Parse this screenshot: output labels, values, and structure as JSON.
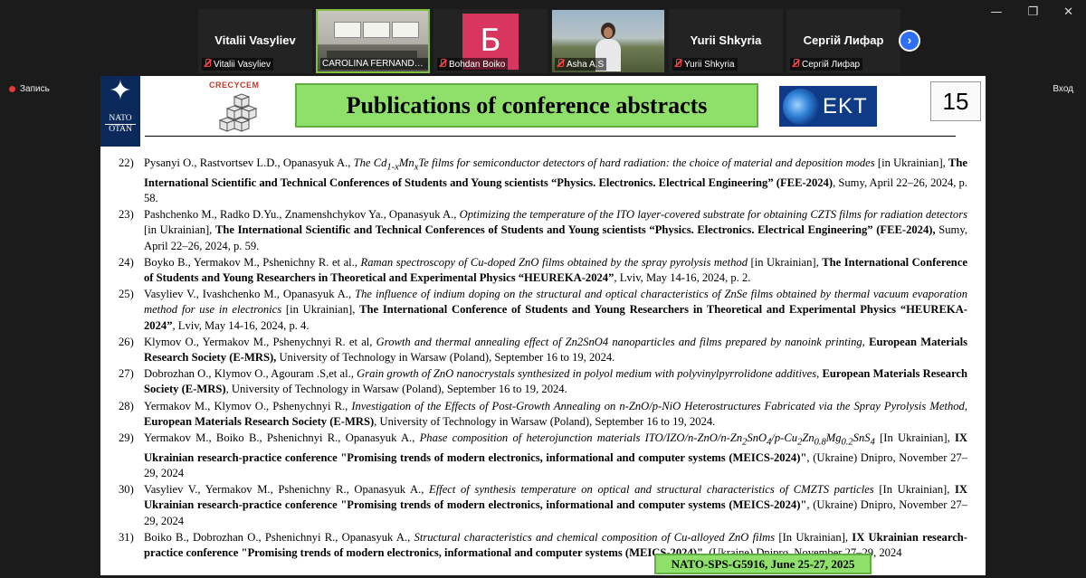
{
  "window": {
    "minimize": "—",
    "restore": "❐",
    "close": "✕"
  },
  "participants": [
    {
      "display": "Vitalii Vasyliev",
      "label": "Vitalii Vasyliev",
      "muted": true
    },
    {
      "display": "",
      "label": "CAROLINA FERNANDEZ S...",
      "muted": false,
      "video": "room"
    },
    {
      "display": "Б",
      "label": "Bohdan Boiko",
      "muted": true,
      "avatar_color": "#d8355f"
    },
    {
      "display": "",
      "label": "Asha A.S",
      "muted": true,
      "video": "person"
    },
    {
      "display": "Yurii Shkyria",
      "label": "Yurii Shkyria",
      "muted": true
    },
    {
      "display": "Сергій Лифар",
      "label": "Сергій Лифар",
      "muted": true
    }
  ],
  "next_button": "›",
  "record_label": "Запись",
  "exit_label": "Вход",
  "slide": {
    "nato_top": "NATO",
    "nato_bottom": "OTAN",
    "crecycle_text": "CRECYCEM",
    "title": "Publications of conference abstracts",
    "ekt_logo": "EKT",
    "page_number": "15",
    "footer": "NATO-SPS-G5916, June 25-27, 2025",
    "references": [
      {
        "n": "22)",
        "html": "Pysanyi O., Rastvortsev L.D., Opanasyuk A., <i>The Cd<sub>1-x</sub>Mn<sub>x</sub>Te films for semiconductor detectors of hard radiation: the choice of material and deposition modes</i> [in Ukrainian], <b>The International Scientific and Technical Conferences of Students and Young scientists “Physics. Electronics. Electrical Engineering” (FEE-2024)</b>, Sumy, April 22–26, 2024, p. 58."
      },
      {
        "n": "23)",
        "html": "Pashchenko M., Radko D.Yu., Znamenshchykov Ya., Opanasyuk A., <i>Optimizing the temperature of the ITO layer-covered substrate for obtaining CZTS films for radiation detectors</i> [in Ukrainian], <b>The International Scientific and Technical Conferences of Students and Young scientists “Physics. Electronics. Electrical Engineering” (FEE-2024),</b> Sumy, April 22–26, 2024, p. 59."
      },
      {
        "n": "24)",
        "html": "Boyko B., Yermakov M., Pshenichny R. et al., <i>Raman spectroscopy of Cu-doped ZnO films obtained by the spray pyrolysis method</i> [in Ukrainian], <b>The International Conference of Students and Young Researchers in Theoretical and Experimental Physics “HEUREKA-2024”</b>, Lviv, May 14-16, 2024, p. 2."
      },
      {
        "n": "25)",
        "html": "Vasyliev V., Ivashchenko M., Opanasyuk A., <i>The influence of indium doping on the structural and optical characteristics of ZnSe films obtained by thermal vacuum evaporation method for use in electronics</i> [in Ukrainian], <b>The International Conference of Students and Young Researchers in Theoretical and Experimental Physics “HEUREKA-2024”</b>, Lviv, May 14-16, 2024, p. 4."
      },
      {
        "n": "26)",
        "html": "Klymov O., Yermakov M., Pshenychnyi R. et al, <i>Growth and thermal annealing effect of Zn2SnO4 nanoparticles and films prepared by nanoink printing</i>, <b>European Materials Research Society (E-MRS),</b> University of Technology in Warsaw (Poland), September 16 to 19, 2024."
      },
      {
        "n": "27)",
        "html": "Dobrozhan O., Klymov O., Agouram .S,et al., <i>Grain growth of ZnO nanocrystals synthesized in polyol medium with polyvinylpyrrolidone additives</i>, <b>European Materials Research Society (E-MRS)</b>, University of Technology in Warsaw (Poland), September 16 to 19, 2024."
      },
      {
        "n": "28)",
        "html": "Yermakov M., Klymov O., Pshenychnyi R., <i>Investigation of the Effects of Post-Growth Annealing on n-ZnO/p-NiO Heterostructures Fabricated via the Spray Pyrolysis Method</i>, <b>European Materials Research Society (E-MRS)</b>, University of Technology in Warsaw (Poland), September 16 to 19, 2024."
      },
      {
        "n": "29)",
        "html": "Yermakov M., Boiko B., Pshenichnyi R., Opanasyuk A., <i>Phase composition of heterojunction materials ITO/IZO/n-ZnO/n-Zn<sub>2</sub>SnO<sub>4</sub>/p-Cu<sub>2</sub>Zn<sub>0.8</sub>Mg<sub>0.2</sub>SnS<sub>4</sub></i> [In Ukrainian], <b>IX Ukrainian research-practice conference \"Promising trends of modern electronics, informational and computer systems (MEICS-2024)\"</b>, (Ukraine) Dnipro, November 27–29, 2024"
      },
      {
        "n": "30)",
        "html": "Vasyliev V., Yermakov M., Pshenichny R., Opanasyuk A., <i>Effect of synthesis temperature on optical and structural characteristics of CMZTS particles</i> [In Ukrainian], <b>IX Ukrainian research-practice conference \"Promising trends of modern electronics, informational and computer systems (MEICS-2024)\"</b>, (Ukraine) Dnipro, November 27–29, 2024"
      },
      {
        "n": "31)",
        "html": "Boiko B., Dobrozhan O., Pshenichnyi R., Opanasyuk A., <i>Structural characteristics and chemical composition of Cu-alloyed ZnO films</i> [In Ukrainian], <b>IX Ukrainian research-practice conference \"Promising trends of modern electronics, informational and computer systems (MEICS-2024)\"</b>, (Ukraine) Dnipro, November 27–29, 2024"
      }
    ]
  }
}
